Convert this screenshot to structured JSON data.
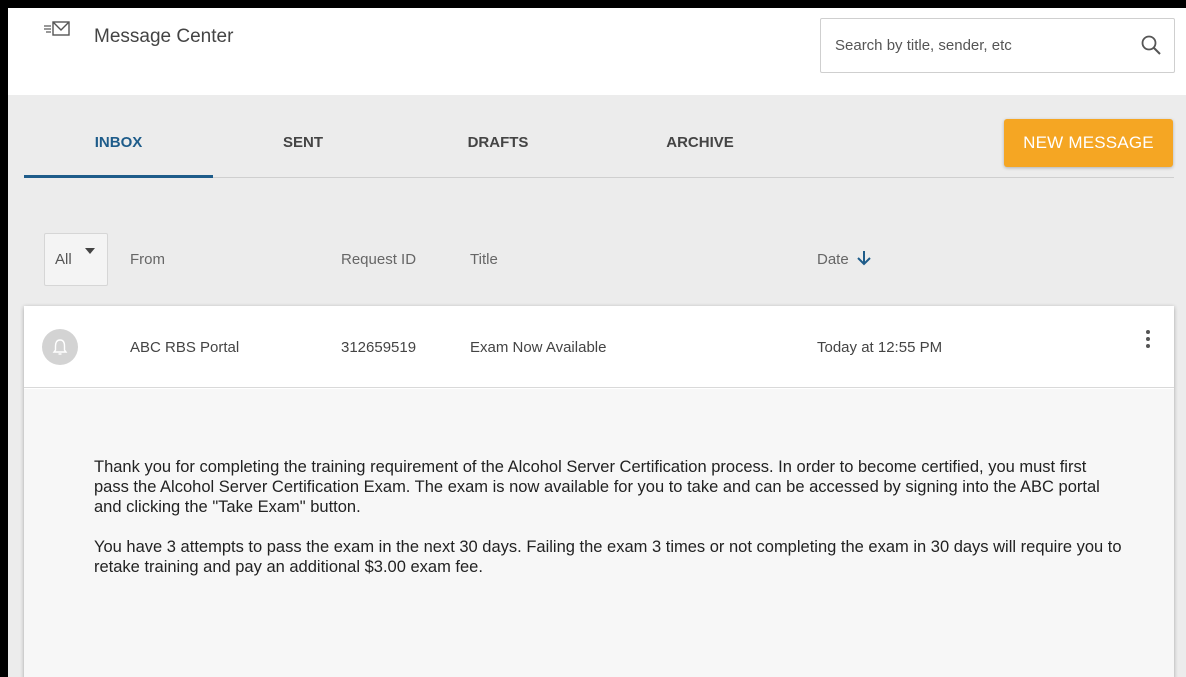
{
  "header": {
    "title": "Message Center",
    "search_placeholder": "Search by title, sender, etc"
  },
  "tabs": [
    {
      "label": "INBOX",
      "active": true
    },
    {
      "label": "SENT",
      "active": false
    },
    {
      "label": "DRAFTS",
      "active": false
    },
    {
      "label": "ARCHIVE",
      "active": false
    }
  ],
  "new_message_label": "NEW MESSAGE",
  "filter": {
    "selected": "All"
  },
  "columns": {
    "from": "From",
    "request_id": "Request ID",
    "title": "Title",
    "date": "Date"
  },
  "messages": [
    {
      "from": "ABC RBS Portal",
      "request_id": "312659519",
      "title": "Exam Now Available",
      "date": "Today at 12:55 PM",
      "body": [
        "Thank you for completing the training requirement of the Alcohol Server Certification process. In order to become certified, you must first pass the Alcohol Server Certification Exam. The exam is now available for you to take and can be accessed by signing into the ABC portal and clicking the \"Take Exam\" button.",
        "You have 3 attempts to pass the exam in the next 30 days. Failing the exam 3 times or not completing the exam in 30 days will require you to retake training and pay an additional $3.00 exam fee."
      ]
    }
  ],
  "colors": {
    "accent": "#1e5c8a",
    "button": "#f5a623",
    "background": "#ececec"
  },
  "icons": {
    "header": "mail-icon",
    "search": "search-icon",
    "sort": "arrow-down-icon",
    "avatar": "bell-icon",
    "row_menu": "more-vertical-icon"
  }
}
